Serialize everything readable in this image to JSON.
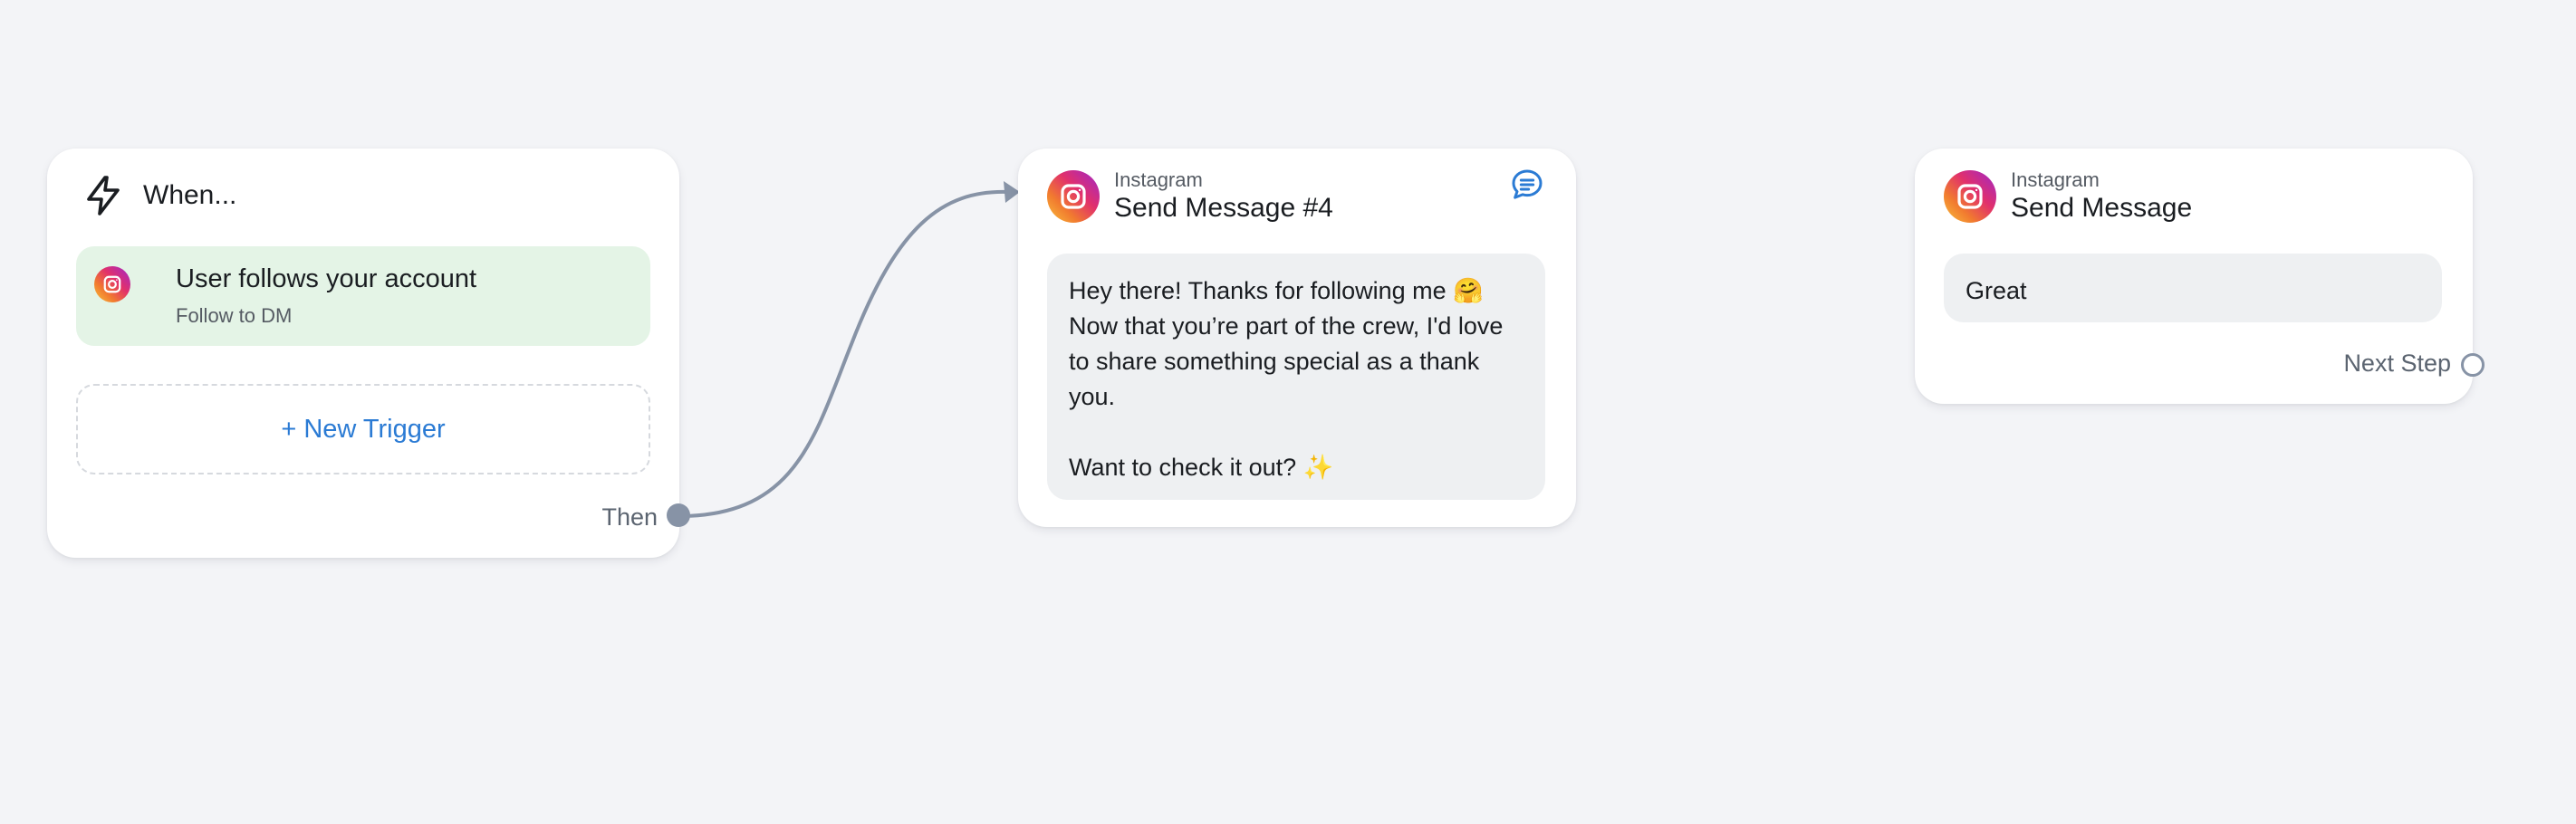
{
  "trigger_card": {
    "title": "When...",
    "trigger": {
      "title": "User follows your account",
      "subtitle": "Follow to DM",
      "icon": "instagram-icon"
    },
    "new_trigger_label": "+ New Trigger",
    "then_label": "Then",
    "header_icon": "lightning-bolt-icon"
  },
  "message_cards": [
    {
      "platform": "Instagram",
      "title": "Send Message #4",
      "icon": "instagram-icon",
      "action_icon": "chat-bubble-icon",
      "message_lines": [
        "Hey there! Thanks for following me 🤗",
        "Now that you’re part of the crew, I'd love",
        "to share something special as a thank",
        "you."
      ],
      "message_lines_after_gap": [
        "Want to check it out? ✨"
      ]
    },
    {
      "platform": "Instagram",
      "title": "Send Message",
      "icon": "instagram-icon",
      "message": "Great",
      "next_step_label": "Next Step"
    }
  ],
  "colors": {
    "canvas_bg": "#f3f4f7",
    "trigger_bg": "#e4f4e6",
    "accent_link": "#2b7bd4",
    "connector": "#8793a6",
    "bubble_bg": "#eef0f2"
  }
}
